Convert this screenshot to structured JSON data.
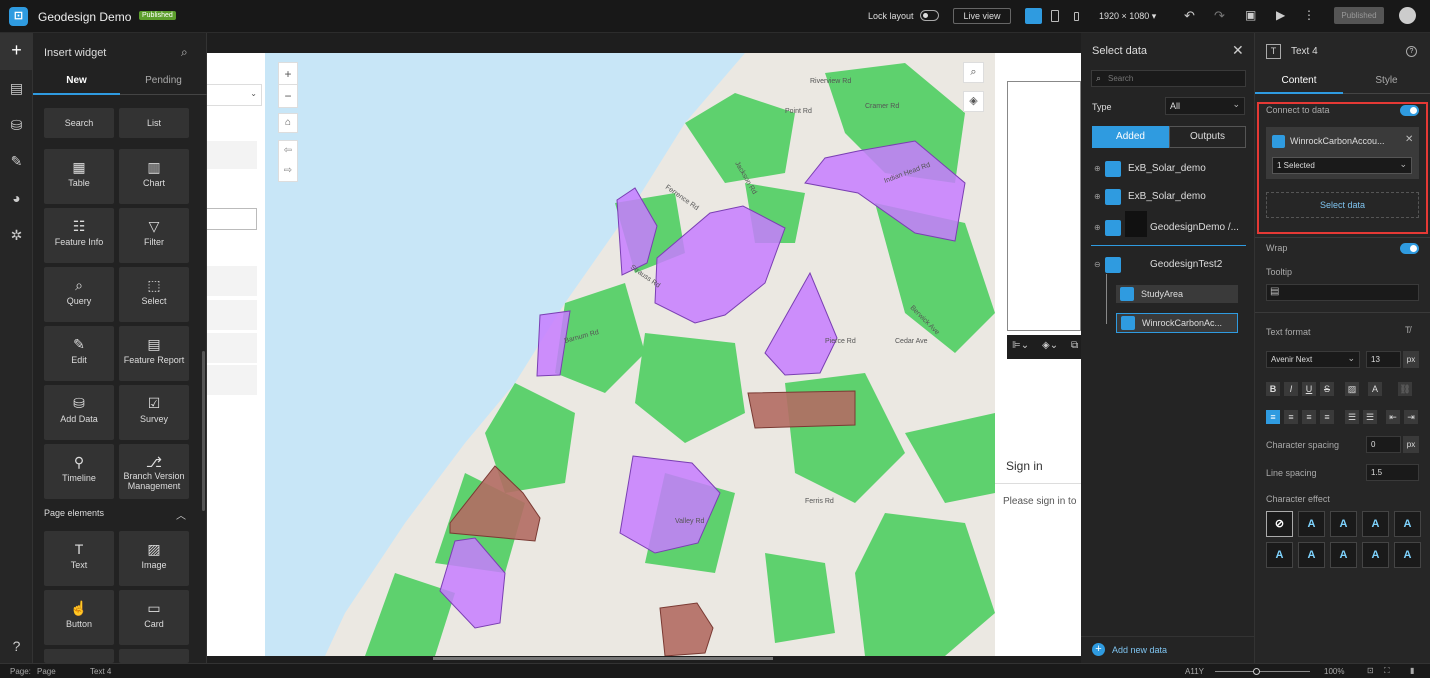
{
  "app": {
    "title": "Geodesign Demo",
    "badge": "Published",
    "lock_layout": "Lock layout",
    "live_view": "Live view",
    "resolution": "1920 × 1080 ▾",
    "publish": "Published"
  },
  "insert": {
    "title": "Insert widget",
    "tabs": [
      "New",
      "Pending"
    ],
    "widgets": [
      {
        "label": "Search",
        "icon": ""
      },
      {
        "label": "List",
        "icon": ""
      },
      {
        "label": "Table",
        "icon": "▦"
      },
      {
        "label": "Chart",
        "icon": "▥"
      },
      {
        "label": "Feature Info",
        "icon": "☷"
      },
      {
        "label": "Filter",
        "icon": "▽"
      },
      {
        "label": "Query",
        "icon": "⌕"
      },
      {
        "label": "Select",
        "icon": "⬚"
      },
      {
        "label": "Edit",
        "icon": "✎"
      },
      {
        "label": "Feature Report",
        "icon": "▤"
      },
      {
        "label": "Add Data",
        "icon": "⛁"
      },
      {
        "label": "Survey",
        "icon": "☑"
      },
      {
        "label": "Timeline",
        "icon": "⚲"
      },
      {
        "label": "Branch Version Management",
        "icon": "⎇"
      }
    ],
    "page_elements_title": "Page elements",
    "page_elements": [
      {
        "label": "Text",
        "icon": "T"
      },
      {
        "label": "Image",
        "icon": "▨"
      },
      {
        "label": "Button",
        "icon": "☝"
      },
      {
        "label": "Card",
        "icon": "▭"
      }
    ]
  },
  "map": {
    "road_labels": [
      "Riverview Rd",
      "Point Rd",
      "Ferrence Rd",
      "Jackson Rd",
      "Indian Head Rd",
      "Cramer Rd",
      "Strauss Rd",
      "Barnum Rd",
      "Berwick Ave",
      "Cedar Ave",
      "Valley Rd",
      "Pierce Rd",
      "Ferris Rd"
    ],
    "signin_title": "Sign in",
    "signin_text": "Please sign in to"
  },
  "select_data": {
    "title": "Select data",
    "search_placeholder": "Search",
    "type_label": "Type",
    "type_value": "All",
    "tabs": [
      "Added",
      "Outputs"
    ],
    "items": [
      "ExB_Solar_demo",
      "ExB_Solar_demo",
      "GeodesignDemo /..."
    ],
    "group": "GeodesignTest2",
    "children": [
      "StudyArea",
      "WinrockCarbonAc..."
    ],
    "add_new": "Add new data"
  },
  "props": {
    "title": "Text 4",
    "tabs": [
      "Content",
      "Style"
    ],
    "connect_label": "Connect to data",
    "data_source": "WinrockCarbonAccou...",
    "selection": "1 Selected",
    "select_data_btn": "Select data",
    "wrap_label": "Wrap",
    "tooltip_label": "Tooltip",
    "text_format_label": "Text format",
    "font": "Avenir Next",
    "font_size": "13",
    "font_unit": "px",
    "format_buttons": [
      "B",
      "I",
      "U",
      "S"
    ],
    "char_spacing_label": "Character spacing",
    "char_spacing": "0",
    "line_spacing_label": "Line spacing",
    "line_spacing": "1.5",
    "char_effect_label": "Character effect"
  },
  "status": {
    "page_label": "Page:",
    "page_value": "Page",
    "selected": "Text 4",
    "a11y": "A11Y",
    "zoom": "100%"
  },
  "colors": {
    "accent": "#2f9be0",
    "highlight": "#e53935",
    "water": "#c8e6f7",
    "land": "#ebe8e2",
    "forest": "#5ed16e",
    "purple": "#c77dff",
    "brown": "#b36b63"
  }
}
